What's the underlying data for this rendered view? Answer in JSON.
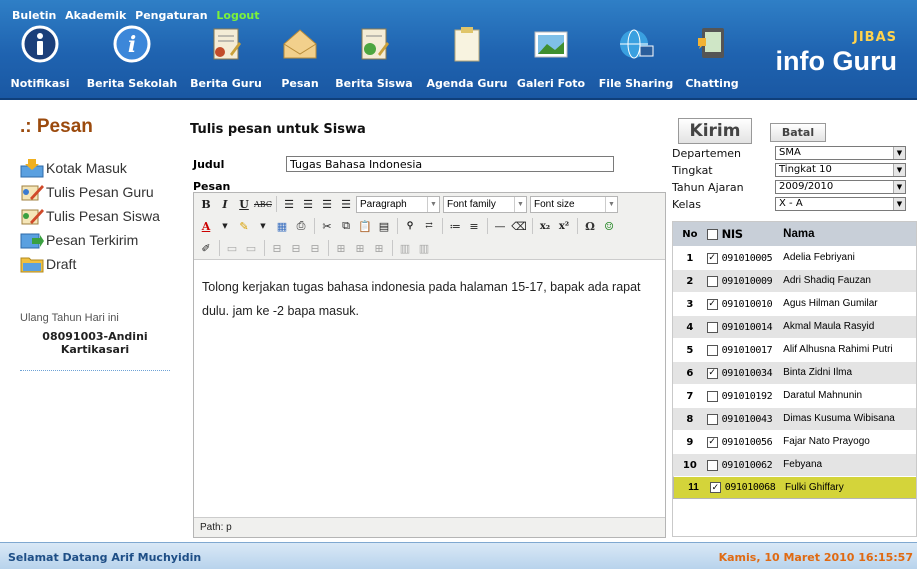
{
  "header": {
    "top_menu": [
      "Buletin",
      "Akademik",
      "Pengaturan"
    ],
    "logout": "Logout",
    "icons": [
      {
        "label": "Notifikasi",
        "icon": "info-icon"
      },
      {
        "label": "Berita Sekolah",
        "icon": "info-circle-icon"
      },
      {
        "label": "Berita Guru",
        "icon": "teacher-news-icon"
      },
      {
        "label": "Pesan",
        "icon": "envelope-icon"
      },
      {
        "label": "Berita Siswa",
        "icon": "student-news-icon"
      },
      {
        "label": "Agenda Guru",
        "icon": "clipboard-icon"
      },
      {
        "label": "Galeri Foto",
        "icon": "photo-icon"
      },
      {
        "label": "File Sharing",
        "icon": "globe-computer-icon"
      },
      {
        "label": "Chatting",
        "icon": "chat-icon"
      }
    ],
    "logo_small": "JIBAS",
    "logo_big": "info Guru"
  },
  "left": {
    "title": ".: Pesan",
    "nav": [
      {
        "label": "Kotak Masuk",
        "icon": "inbox-icon"
      },
      {
        "label": "Tulis Pesan Guru",
        "icon": "write-teacher-icon"
      },
      {
        "label": "Tulis Pesan Siswa",
        "icon": "write-student-icon"
      },
      {
        "label": "Pesan Terkirim",
        "icon": "sent-icon"
      },
      {
        "label": "Draft",
        "icon": "draft-folder-icon"
      }
    ],
    "birthday_heading": "Ulang Tahun Hari ini",
    "birthday_name": "08091003-Andini Kartikasari"
  },
  "form": {
    "title": "Tulis pesan untuk Siswa",
    "judul_label": "Judul",
    "judul_value": "Tugas Bahasa Indonesia",
    "pesan_label": "Pesan",
    "paragraph_select": "Paragraph",
    "font_family_select": "Font family",
    "font_size_select": "Font size",
    "body_text": "Tolong kerjakan tugas bahasa indonesia pada halaman 15-17, bapak ada rapat dulu. jam ke -2 bapa masuk.",
    "path": "Path: p"
  },
  "actions": {
    "kirim": "Kirim",
    "batal": "Batal"
  },
  "filters": [
    {
      "label": "Departemen",
      "value": "SMA"
    },
    {
      "label": "Tingkat",
      "value": "Tingkat 10"
    },
    {
      "label": "Tahun Ajaran",
      "value": "2009/2010"
    },
    {
      "label": "Kelas",
      "value": "X - A"
    }
  ],
  "table": {
    "columns": [
      "No",
      "NIS",
      "Nama"
    ],
    "rows": [
      {
        "no": "1",
        "checked": true,
        "nis": "091010005",
        "nama": "Adelia Febriyani"
      },
      {
        "no": "2",
        "checked": false,
        "nis": "091010009",
        "nama": "Adri Shadiq Fauzan"
      },
      {
        "no": "3",
        "checked": true,
        "nis": "091010010",
        "nama": "Agus Hilman Gumilar"
      },
      {
        "no": "4",
        "checked": false,
        "nis": "091010014",
        "nama": "Akmal Maula Rasyid"
      },
      {
        "no": "5",
        "checked": false,
        "nis": "091010017",
        "nama": "Alif Alhusna Rahimi Putri"
      },
      {
        "no": "6",
        "checked": true,
        "nis": "091010034",
        "nama": "Binta Zidni Ilma"
      },
      {
        "no": "7",
        "checked": false,
        "nis": "091010192",
        "nama": "Daratul Mahnunin"
      },
      {
        "no": "8",
        "checked": false,
        "nis": "091010043",
        "nama": "Dimas Kusuma Wibisana"
      },
      {
        "no": "9",
        "checked": true,
        "nis": "091010056",
        "nama": "Fajar Nato Prayogo"
      },
      {
        "no": "10",
        "checked": false,
        "nis": "091010062",
        "nama": "Febyana"
      },
      {
        "no": "11",
        "checked": true,
        "nis": "091010068",
        "nama": "Fulki Ghiffary"
      }
    ]
  },
  "footer": {
    "welcome": "Selamat Datang Arif Muchyidin",
    "datetime": "Kamis, 10 Maret 2010 16:15:57"
  },
  "colors": {
    "header_blue": "#1f63b0",
    "title_brown": "#9b4a0d",
    "selected_row": "#d4d43a",
    "datetime_orange": "#e06a12"
  }
}
